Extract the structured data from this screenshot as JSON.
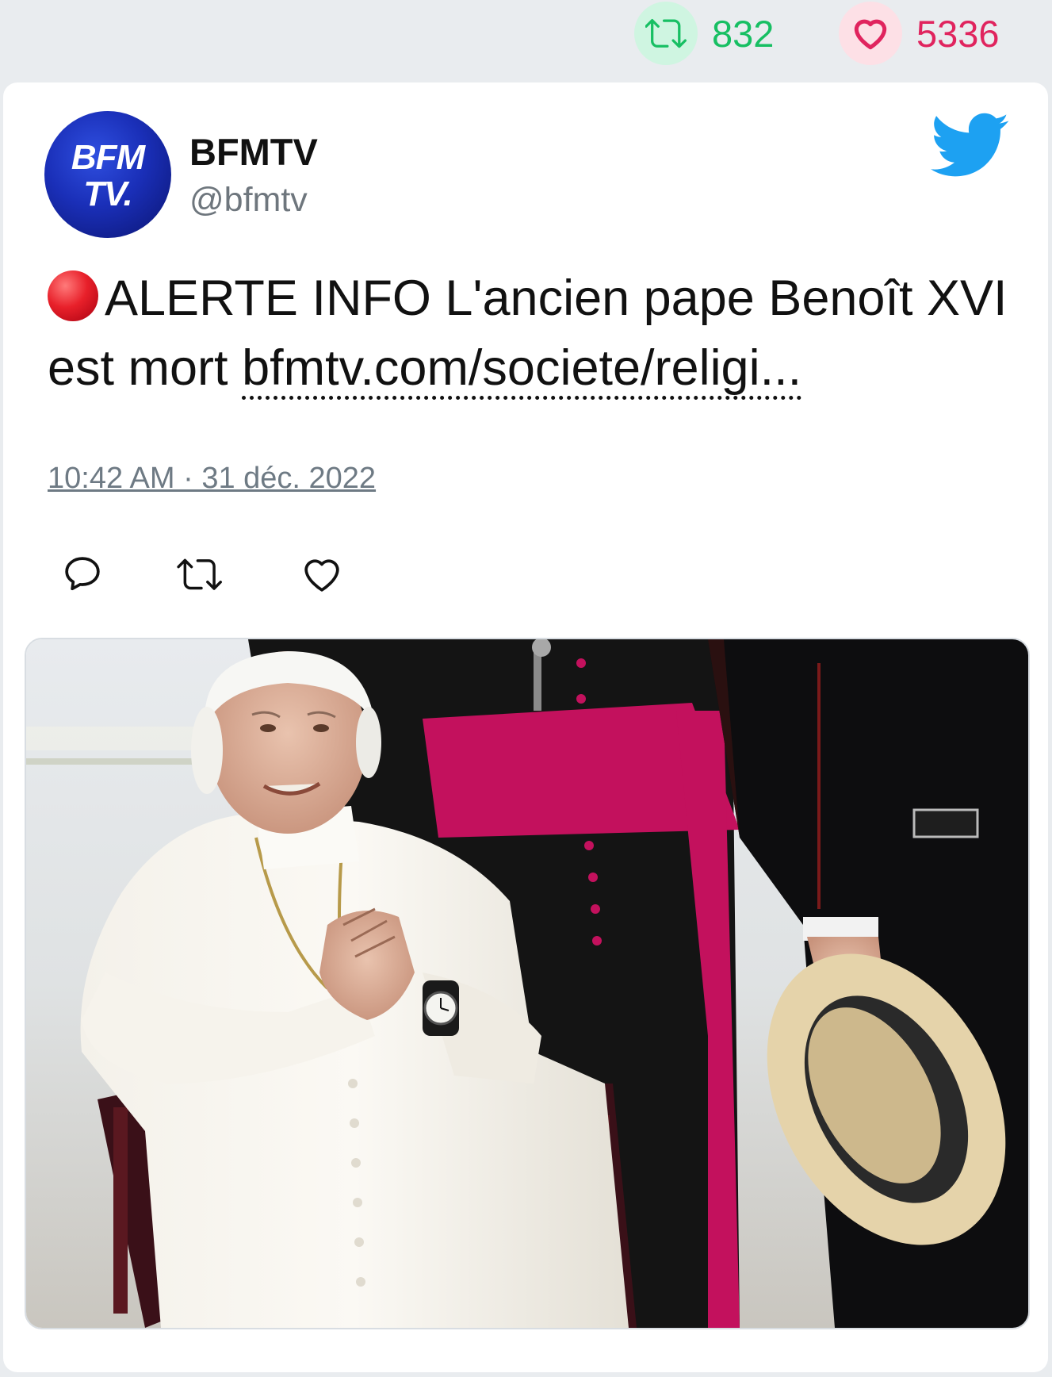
{
  "stats": {
    "retweets": "832",
    "likes": "5336"
  },
  "tweet": {
    "display_name": "BFMTV",
    "handle": "@bfmtv",
    "avatar_line1": "BFM",
    "avatar_line2": "TV.",
    "text_main": "ALERTE INFO L'ancien pape Benoît XVI est mort ",
    "link": "bfmtv.com/societe/religi...",
    "timestamp": "10:42 AM · 31 déc. 2022"
  },
  "icons": {
    "retweet": "retweet-icon",
    "like": "heart-icon",
    "reply": "reply-icon",
    "brand": "twitter-bird-icon",
    "alert": "red-circle-icon"
  },
  "colors": {
    "retweet_green": "#17bf63",
    "like_red": "#e0245e",
    "twitter_blue": "#1da1f2",
    "meta_gray": "#6e767d"
  }
}
